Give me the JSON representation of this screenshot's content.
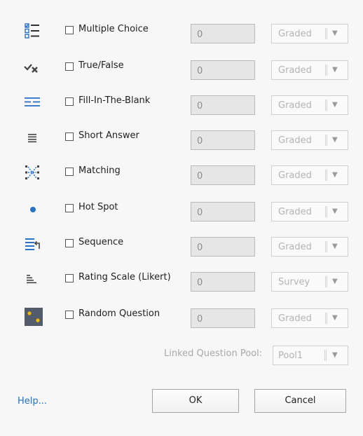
{
  "questions": [
    {
      "id": "multiple-choice",
      "label": "Multiple Choice",
      "count": "0",
      "mode": "Graded",
      "icon": "list-checkbox-icon"
    },
    {
      "id": "true-false",
      "label": "True/False",
      "count": "0",
      "mode": "Graded",
      "icon": "check-cross-icon"
    },
    {
      "id": "fill-in-the-blank",
      "label": "Fill-In-The-Blank",
      "count": "0",
      "mode": "Graded",
      "icon": "blank-lines-icon"
    },
    {
      "id": "short-answer",
      "label": "Short Answer",
      "count": "0",
      "mode": "Graded",
      "icon": "text-lines-icon"
    },
    {
      "id": "matching",
      "label": "Matching",
      "count": "0",
      "mode": "Graded",
      "icon": "matching-icon"
    },
    {
      "id": "hot-spot",
      "label": "Hot Spot",
      "count": "0",
      "mode": "Graded",
      "icon": "dot-icon"
    },
    {
      "id": "sequence",
      "label": "Sequence",
      "count": "0",
      "mode": "Graded",
      "icon": "sequence-icon"
    },
    {
      "id": "rating-scale",
      "label": "Rating Scale (Likert)",
      "count": "0",
      "mode": "Survey",
      "icon": "bar-scale-icon"
    },
    {
      "id": "random-question",
      "label": "Random Question",
      "count": "0",
      "mode": "Graded",
      "icon": "dice-icon"
    }
  ],
  "pool": {
    "label": "Linked Question Pool:",
    "value": "Pool1"
  },
  "footer": {
    "help": "Help...",
    "ok": "OK",
    "cancel": "Cancel"
  },
  "colors": {
    "accent": "#2a72c8",
    "link": "#2a6ebd",
    "dice": "#525c6a",
    "dice_pip": "#f2b705"
  }
}
